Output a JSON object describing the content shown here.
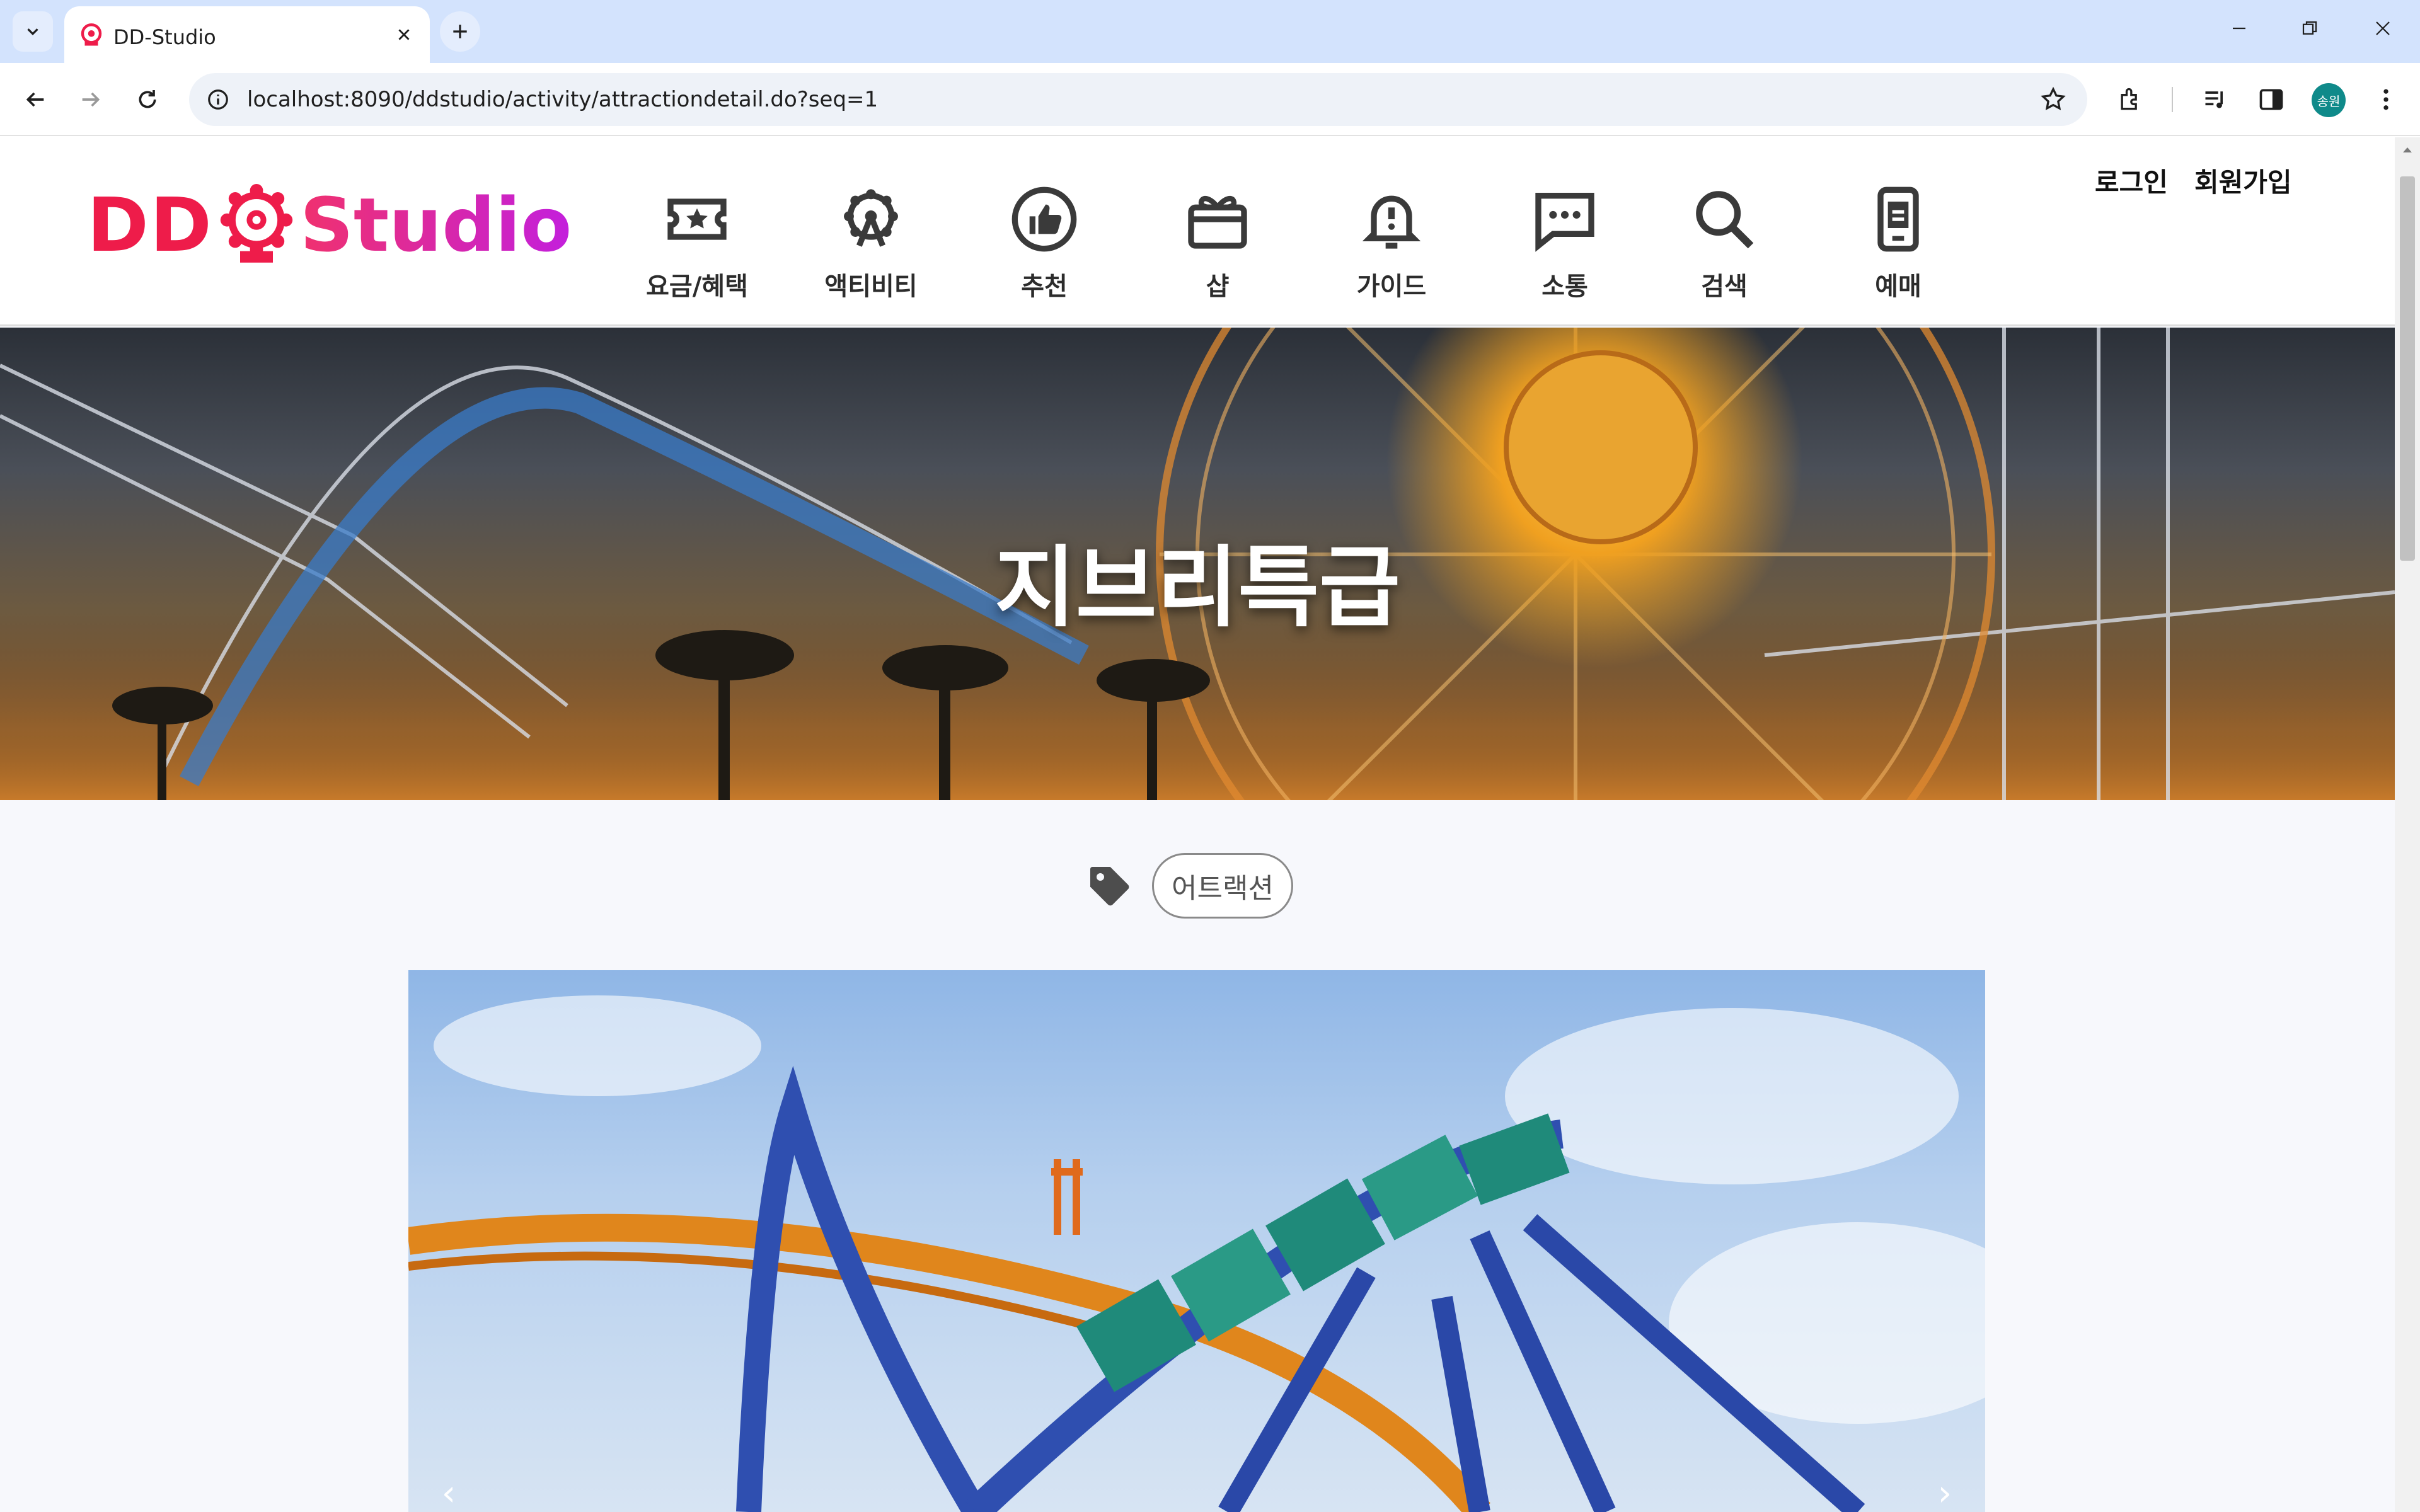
{
  "browser": {
    "tab_title": "DD-Studio",
    "url": "localhost:8090/ddstudio/activity/attractiondetail.do?seq=1",
    "profile_initials": "송원"
  },
  "site": {
    "logo_left": "DD",
    "logo_right": "Studio",
    "nav": [
      {
        "label": "요금/혜택",
        "icon": "ticket-star-icon"
      },
      {
        "label": "액티비티",
        "icon": "ferris-wheel-icon"
      },
      {
        "label": "추천",
        "icon": "thumbs-up-icon"
      },
      {
        "label": "샵",
        "icon": "gift-box-icon"
      },
      {
        "label": "가이드",
        "icon": "bell-alert-icon"
      },
      {
        "label": "소통",
        "icon": "chat-bubble-icon"
      },
      {
        "label": "검색",
        "icon": "search-icon"
      },
      {
        "label": "예매",
        "icon": "mobile-ticket-icon"
      }
    ],
    "login": "로그인",
    "signup": "회원가입"
  },
  "hero": {
    "title": "지브리특급"
  },
  "tag": {
    "label": "어트랙션"
  },
  "carousel": {
    "prev": "‹",
    "next": "›"
  },
  "colors": {
    "brand_red": "#ee1c4a",
    "brand_magenta": "#c31fdd",
    "chrome_blue": "#d3e3fd",
    "nav_icon": "#3a3a3a"
  }
}
